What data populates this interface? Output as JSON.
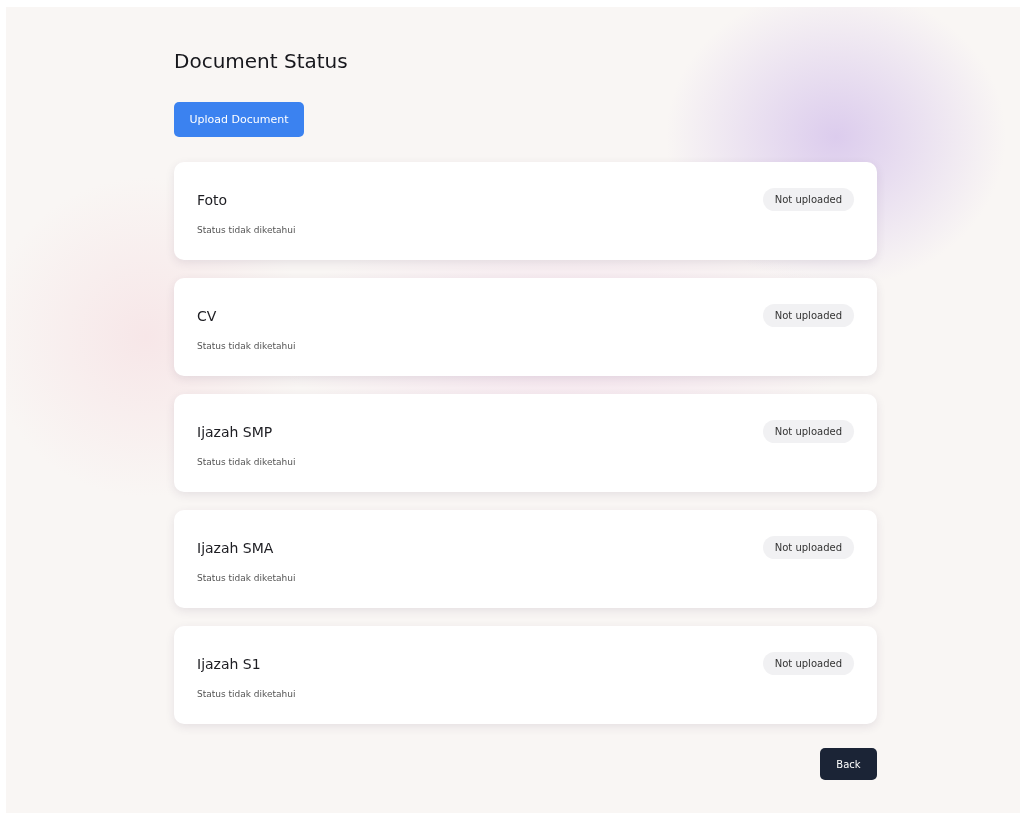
{
  "title": "Document Status",
  "upload_button": "Upload Document",
  "documents": [
    {
      "name": "Foto",
      "description": "Status tidak diketahui",
      "badge": "Not uploaded"
    },
    {
      "name": "CV",
      "description": "Status tidak diketahui",
      "badge": "Not uploaded"
    },
    {
      "name": "Ijazah SMP",
      "description": "Status tidak diketahui",
      "badge": "Not uploaded"
    },
    {
      "name": "Ijazah SMA",
      "description": "Status tidak diketahui",
      "badge": "Not uploaded"
    },
    {
      "name": "Ijazah S1",
      "description": "Status tidak diketahui",
      "badge": "Not uploaded"
    }
  ],
  "back_button": "Back"
}
